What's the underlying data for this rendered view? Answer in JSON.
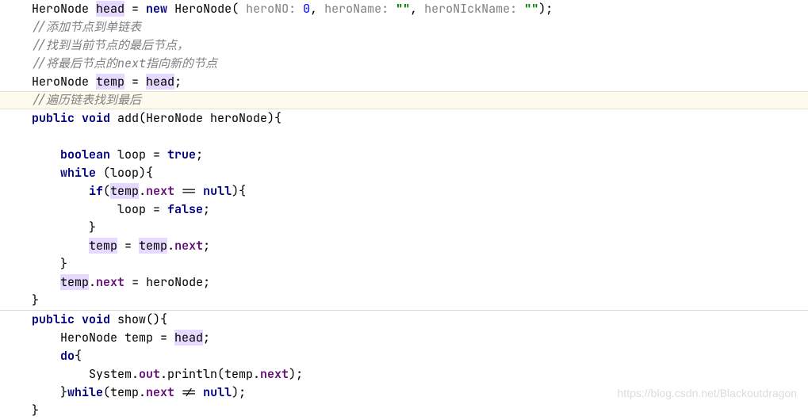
{
  "watermark": "https://blog.csdn.net/Blackoutdragon",
  "code": {
    "l1_a": "HeroNode ",
    "l1_head": "head",
    "l1_b": " = ",
    "l1_new": "new",
    "l1_c": " HeroNode( ",
    "l1_h1": "heroNO: ",
    "l1_n": "0",
    "l1_d": ", ",
    "l1_h2": "heroName: ",
    "l1_s1": "\"\"",
    "l1_e": ", ",
    "l1_h3": "heroNIckName: ",
    "l1_s2": "\"\"",
    "l1_f": ");",
    "c1": "//添加节点到单链表",
    "c2": "//找到当前节点的最后节点，",
    "c3": "//将最后节点的next指向新的节点",
    "l5_a": "HeroNode ",
    "l5_temp": "temp",
    "l5_b": " = ",
    "l5_head": "head",
    "l5_c": ";",
    "c4": "//遍历链表找到最后",
    "l7_a": "public",
    "l7_b": " ",
    "l7_c": "void",
    "l7_d": " add(HeroNode heroNode){",
    "blank": "",
    "l9_a": "    ",
    "l9_b": "boolean",
    "l9_c": " loop = ",
    "l9_d": "true",
    "l9_e": ";",
    "l10_a": "    ",
    "l10_b": "while",
    "l10_c": " (loop){",
    "l11_a": "        ",
    "l11_b": "if",
    "l11_c": "(",
    "l11_temp": "temp",
    "l11_d": ".",
    "l11_next": "next",
    "l11_e": " == ",
    "l11_null": "null",
    "l11_f": "){",
    "l12_a": "            loop = ",
    "l12_b": "false",
    "l12_c": ";",
    "l13": "        }",
    "l14_a": "        ",
    "l14_temp": "temp",
    "l14_b": " = ",
    "l14_temp2": "temp",
    "l14_c": ".",
    "l14_next": "next",
    "l14_d": ";",
    "l15": "    }",
    "l16_a": "    ",
    "l16_temp": "temp",
    "l16_b": ".",
    "l16_next": "next",
    "l16_c": " = heroNode;",
    "l17": "}",
    "l18_a": "public",
    "l18_b": " ",
    "l18_c": "void",
    "l18_d": " show(){",
    "l19_a": "    HeroNode temp = ",
    "l19_head": "head",
    "l19_b": ";",
    "l20_a": "    ",
    "l20_b": "do",
    "l20_c": "{",
    "l21_a": "        System.",
    "l21_out": "out",
    "l21_b": ".println(temp.",
    "l21_next": "next",
    "l21_c": ");",
    "l22_a": "    }",
    "l22_b": "while",
    "l22_c": "(temp.",
    "l22_next": "next",
    "l22_d": " != ",
    "l22_null": "null",
    "l22_e": ");",
    "l23": "}"
  }
}
